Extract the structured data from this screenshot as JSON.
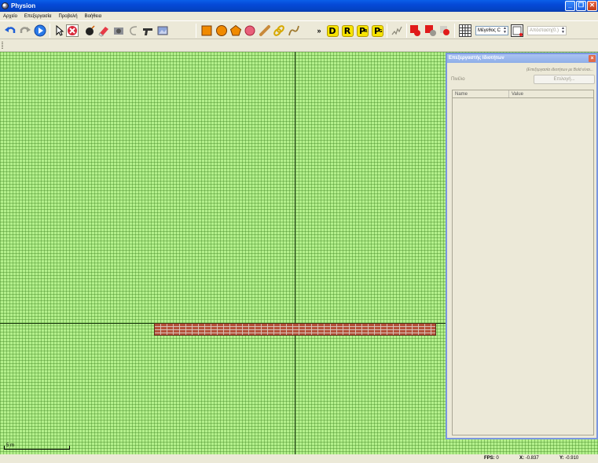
{
  "window": {
    "title": "Physion",
    "buttons": [
      "_",
      "❐",
      "✕"
    ]
  },
  "menu": [
    "Αρχείο",
    "Επεξεργασία",
    "Προβολή",
    "Βοήθεια"
  ],
  "toolbar": {
    "undo_icon": "undo-icon",
    "redo_icon": "redo-icon",
    "play_icon": "play-icon",
    "letters": [
      "D",
      "R",
      "P",
      "P"
    ],
    "letter_subs": [
      "",
      "",
      "R",
      "G"
    ],
    "size_select": "Μέγεθος C",
    "distance_field": "Απόσταση(0.)"
  },
  "panel": {
    "title": "Επεξεργαστής Ιδιοτήτων",
    "hint": "(Επεξεργασία ιδιοτήτων με Bold είναι...",
    "field_label": "Πινέλο",
    "select_button": "Επιλογή...",
    "columns": [
      "Name",
      "Value"
    ]
  },
  "canvas": {
    "scale_label": "5 m"
  },
  "status": {
    "fps_label": "FPS:",
    "fps_value": "0",
    "x_label": "X:",
    "x_value": "-0.837",
    "y_label": "Y:",
    "y_value": "-0.910"
  },
  "colors": {
    "grid_bg": "#b4f08c",
    "brick": "#b5513a",
    "titlebar": "#0549d6"
  }
}
